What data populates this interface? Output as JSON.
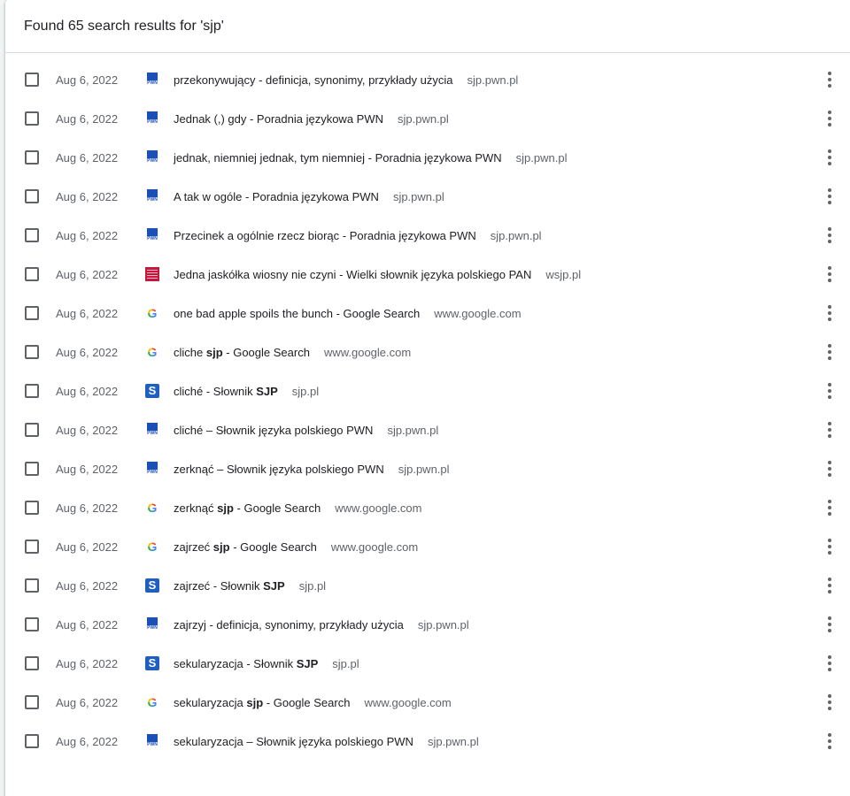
{
  "header": {
    "text": "Found 65 search results for 'sjp'"
  },
  "items": [
    {
      "date": "Aug 6, 2022",
      "icon": "pwn-icon",
      "parts": [
        "przekonywujący - definicja, synonimy, przykłady użycia"
      ],
      "domain": "sjp.pwn.pl"
    },
    {
      "date": "Aug 6, 2022",
      "icon": "pwn-icon",
      "parts": [
        "Jednak (,) gdy - Poradnia językowa PWN"
      ],
      "domain": "sjp.pwn.pl"
    },
    {
      "date": "Aug 6, 2022",
      "icon": "pwn-icon",
      "parts": [
        "jednak, niemniej jednak, tym niemniej - Poradnia językowa PWN"
      ],
      "domain": "sjp.pwn.pl"
    },
    {
      "date": "Aug 6, 2022",
      "icon": "pwn-icon",
      "parts": [
        "A tak w ogóle - Poradnia językowa PWN"
      ],
      "domain": "sjp.pwn.pl"
    },
    {
      "date": "Aug 6, 2022",
      "icon": "pwn-icon",
      "parts": [
        "Przecinek a ogólnie rzecz biorąc - Poradnia językowa PWN"
      ],
      "domain": "sjp.pwn.pl"
    },
    {
      "date": "Aug 6, 2022",
      "icon": "wsjp-icon",
      "parts": [
        "Jedna jaskółka wiosny nie czyni - Wielki słownik języka polskiego PAN"
      ],
      "domain": "wsjp.pl"
    },
    {
      "date": "Aug 6, 2022",
      "icon": "google-icon",
      "parts": [
        "one bad apple spoils the bunch - Google Search"
      ],
      "domain": "www.google.com"
    },
    {
      "date": "Aug 6, 2022",
      "icon": "google-icon",
      "parts": [
        "cliche ",
        "sjp",
        " - Google Search"
      ],
      "domain": "www.google.com"
    },
    {
      "date": "Aug 6, 2022",
      "icon": "sjp-icon",
      "parts": [
        "cliché - Słownik ",
        "SJP",
        ""
      ],
      "domain": "sjp.pl"
    },
    {
      "date": "Aug 6, 2022",
      "icon": "pwn-icon",
      "parts": [
        "cliché – Słownik języka polskiego PWN"
      ],
      "domain": "sjp.pwn.pl"
    },
    {
      "date": "Aug 6, 2022",
      "icon": "pwn-icon",
      "parts": [
        "zerknąć – Słownik języka polskiego PWN"
      ],
      "domain": "sjp.pwn.pl"
    },
    {
      "date": "Aug 6, 2022",
      "icon": "google-icon",
      "parts": [
        "zerknąć ",
        "sjp",
        " - Google Search"
      ],
      "domain": "www.google.com"
    },
    {
      "date": "Aug 6, 2022",
      "icon": "google-icon",
      "parts": [
        "zajrzeć ",
        "sjp",
        " - Google Search"
      ],
      "domain": "www.google.com"
    },
    {
      "date": "Aug 6, 2022",
      "icon": "sjp-icon",
      "parts": [
        "zajrzeć - Słownik ",
        "SJP",
        ""
      ],
      "domain": "sjp.pl"
    },
    {
      "date": "Aug 6, 2022",
      "icon": "pwn-icon",
      "parts": [
        "zajrzyj - definicja, synonimy, przykłady użycia"
      ],
      "domain": "sjp.pwn.pl"
    },
    {
      "date": "Aug 6, 2022",
      "icon": "sjp-icon",
      "parts": [
        "sekularyzacja - Słownik ",
        "SJP",
        ""
      ],
      "domain": "sjp.pl"
    },
    {
      "date": "Aug 6, 2022",
      "icon": "google-icon",
      "parts": [
        "sekularyzacja ",
        "sjp",
        " - Google Search"
      ],
      "domain": "www.google.com"
    },
    {
      "date": "Aug 6, 2022",
      "icon": "pwn-icon",
      "parts": [
        "sekularyzacja – Słownik języka polskiego PWN"
      ],
      "domain": "sjp.pwn.pl"
    }
  ],
  "icon_text": {
    "pwn": "PWN",
    "google": "G",
    "sjp": "S"
  },
  "colors": {
    "pwn": "#1a4fb8",
    "wsjp": "#c4183c",
    "sjp": "#1f5fbf"
  }
}
